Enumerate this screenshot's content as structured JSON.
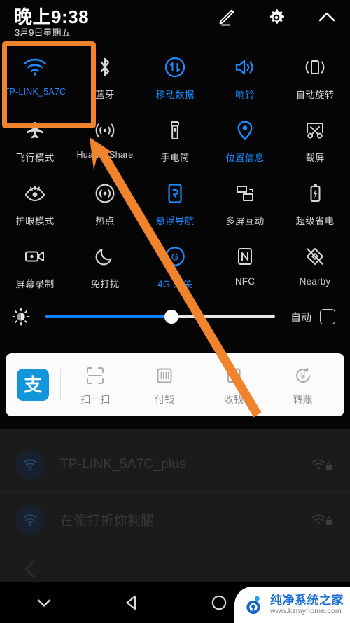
{
  "statusbar": {
    "time": "晚上9:38",
    "date": "3月9日星期五",
    "icons": [
      {
        "name": "edit-icon",
        "label": "编辑"
      },
      {
        "name": "settings-gear-icon",
        "label": "设置"
      },
      {
        "name": "chevron-up-icon",
        "label": "收起"
      }
    ]
  },
  "quick_settings": {
    "rows": [
      [
        {
          "icon": "wifi-icon",
          "label": "TP-LINK_5A7C",
          "active": true,
          "small": true
        },
        {
          "icon": "bluetooth-icon",
          "label": "蓝牙",
          "active": false,
          "small": false
        },
        {
          "icon": "mobile-data-icon",
          "label": "移动数据",
          "active": true,
          "small": false
        },
        {
          "icon": "ringer-icon",
          "label": "响铃",
          "active": true,
          "small": false
        },
        {
          "icon": "auto-rotate-icon",
          "label": "自动旋转",
          "active": false,
          "small": false
        }
      ],
      [
        {
          "icon": "airplane-icon",
          "label": "飞行模式",
          "active": false,
          "small": false
        },
        {
          "icon": "huawei-share-icon",
          "label": "Huawei Share",
          "active": false,
          "small": true
        },
        {
          "icon": "flashlight-icon",
          "label": "手电筒",
          "active": false,
          "small": false
        },
        {
          "icon": "location-pin-icon",
          "label": "位置信息",
          "active": true,
          "small": false
        },
        {
          "icon": "screenshot-icon",
          "label": "截屏",
          "active": false,
          "small": false
        }
      ],
      [
        {
          "icon": "eye-comfort-icon",
          "label": "护眼模式",
          "active": false,
          "small": false
        },
        {
          "icon": "hotspot-icon",
          "label": "热点",
          "active": false,
          "small": false
        },
        {
          "icon": "nav-dock-icon",
          "label": "悬浮导航",
          "active": true,
          "small": false
        },
        {
          "icon": "multiscreen-icon",
          "label": "多屏互动",
          "active": false,
          "small": false
        },
        {
          "icon": "battery-saver-icon",
          "label": "超级省电",
          "active": false,
          "small": false
        }
      ],
      [
        {
          "icon": "screen-record-icon",
          "label": "屏幕录制",
          "active": false,
          "small": false
        },
        {
          "icon": "do-not-disturb-icon",
          "label": "免打扰",
          "active": false,
          "small": false
        },
        {
          "icon": "4g-toggle-icon",
          "label": "4G 开关",
          "active": true,
          "small": false
        },
        {
          "icon": "nfc-icon",
          "label": "NFC",
          "active": false,
          "small": false
        },
        {
          "icon": "nearby-off-icon",
          "label": "Nearby",
          "active": false,
          "small": false
        }
      ]
    ]
  },
  "brightness": {
    "icon": "brightness-icon",
    "value_percent": 55,
    "auto_label": "自动",
    "auto_checked": false
  },
  "alipay_card": {
    "logo": "alipay-logo",
    "actions": [
      {
        "icon": "scan-icon",
        "label": "扫一扫"
      },
      {
        "icon": "barcode-icon",
        "label": "付钱"
      },
      {
        "icon": "receive-icon",
        "label": "收钱"
      },
      {
        "icon": "transfer-icon",
        "label": "转账"
      }
    ]
  },
  "wifi_list": {
    "items": [
      {
        "name": "TP-LINK_5A7C_plus",
        "secured": true
      },
      {
        "name": "在偷打折你狗腿",
        "secured": true
      }
    ]
  },
  "navbar": {
    "buttons": [
      {
        "name": "collapse-chevron-down",
        "label": "收起"
      },
      {
        "name": "back-button",
        "label": "返回"
      },
      {
        "name": "home-button",
        "label": "主页"
      }
    ]
  },
  "watermark": {
    "site_name": "纯净系统之家",
    "url": "www.kzmyhome.com"
  },
  "annotation": {
    "highlight_color": "#f0842c",
    "highlight_target": "TP-LINK_5A7C",
    "arrow_color": "#f0842c"
  }
}
